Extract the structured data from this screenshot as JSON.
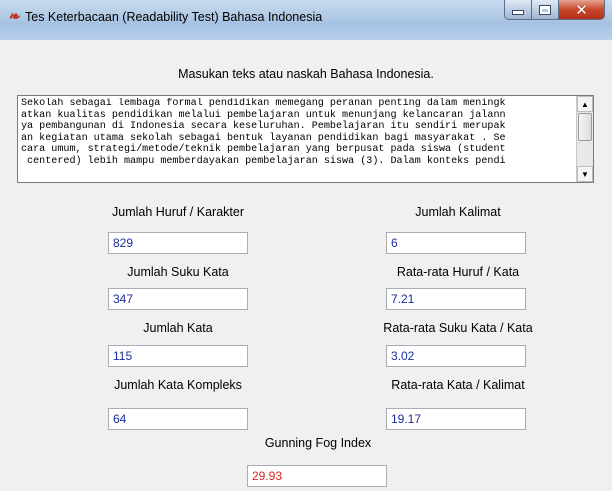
{
  "window": {
    "title": "Tes Keterbacaan (Readability Test) Bahasa Indonesia",
    "icon_glyph": "❧",
    "controls": [
      "minimize-icon",
      "maximize-icon",
      "close-icon"
    ]
  },
  "instruction": "Masukan teks atau naskah Bahasa Indonesia.",
  "text_input": {
    "lines": [
      "Sekolah sebagai lembaga formal pendidikan memegang peranan penting dalam meningk",
      "atkan kualitas pendidikan melalui pembelajaran untuk menunjang kelancaran jalann",
      "ya pembangunan di Indonesia secara keseluruhan. Pembelajaran itu sendiri merupak",
      "an kegiatan utama sekolah sebagai bentuk layanan pendidikan bagi masyarakat . Se",
      "cara umum, strategi/metode/teknik pembelajaran yang berpusat pada siswa (student",
      " centered) lebih mampu memberdayakan pembelajaran siswa (3). Dalam konteks pendi"
    ]
  },
  "stats": {
    "jumlah_huruf": {
      "label": "Jumlah Huruf / Karakter",
      "value": "829"
    },
    "jumlah_kalimat": {
      "label": "Jumlah Kalimat",
      "value": "6"
    },
    "jumlah_suku_kata": {
      "label": "Jumlah Suku Kata",
      "value": "347"
    },
    "rata_huruf_kata": {
      "label": "Rata-rata Huruf / Kata",
      "value": "7.21"
    },
    "jumlah_kata": {
      "label": "Jumlah Kata",
      "value": "115"
    },
    "rata_suku_kata": {
      "label": "Rata-rata Suku Kata / Kata",
      "value": "3.02"
    },
    "jumlah_kata_kompleks": {
      "label": "Jumlah Kata Kompleks",
      "value": "64"
    },
    "rata_kata_kalimat": {
      "label": "Rata-rata Kata / Kalimat",
      "value": "19.17"
    },
    "gunning_fog": {
      "label": "Gunning Fog Index",
      "value": "29.93"
    }
  },
  "colors": {
    "value_text": "#1a2f9e",
    "fog_value_text": "#d8261c",
    "titlebar": "#b3cbe6"
  }
}
